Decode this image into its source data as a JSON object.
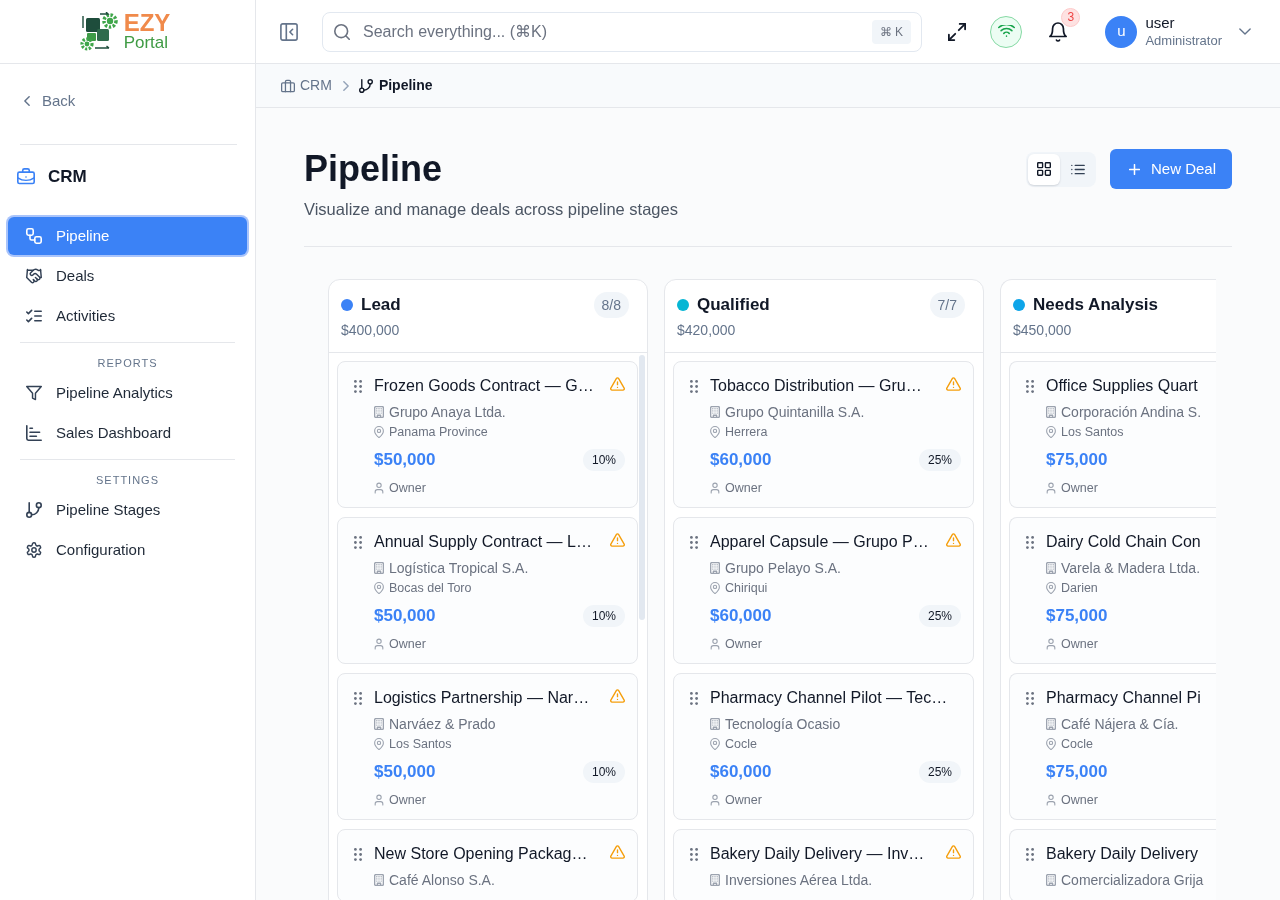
{
  "brand": {
    "name": "EZY",
    "tagline": "Portal"
  },
  "sidebar": {
    "back": "Back",
    "module": "CRM",
    "groups": [
      {
        "items": [
          {
            "kind": "pipeline",
            "label": "Pipeline",
            "selected": true
          },
          {
            "kind": "deals",
            "label": "Deals",
            "selected": false
          },
          {
            "kind": "activities",
            "label": "Activities",
            "selected": false
          }
        ]
      },
      {
        "heading": "REPORTS",
        "items": [
          {
            "kind": "analytics",
            "label": "Pipeline Analytics",
            "selected": false
          },
          {
            "kind": "dashboard",
            "label": "Sales Dashboard",
            "selected": false
          }
        ]
      },
      {
        "heading": "SETTINGS",
        "items": [
          {
            "kind": "stages",
            "label": "Pipeline Stages",
            "selected": false
          },
          {
            "kind": "configuration",
            "label": "Configuration",
            "selected": false
          }
        ]
      }
    ]
  },
  "topbar": {
    "search": {
      "placeholder": "Search everything... (⌘K)",
      "shortcut": "⌘ K"
    },
    "connected": true,
    "notifications": "3",
    "user": {
      "initial": "u",
      "name": "user",
      "role": "Administrator"
    }
  },
  "breadcrumb": [
    {
      "kind": "module",
      "label": "CRM",
      "current": false
    },
    {
      "kind": "pipeline",
      "label": "Pipeline",
      "current": true
    }
  ],
  "page": {
    "title": "Pipeline",
    "subtitle": "Visualize and manage deals across pipeline stages",
    "view_modes": [
      {
        "kind": "grid",
        "selected": true
      },
      {
        "kind": "list",
        "selected": false
      }
    ],
    "new_button": "New Deal"
  },
  "stages": [
    {
      "name": "Lead",
      "color": "#3b82f6",
      "count": "8/8",
      "total": "$400,000",
      "scrollbar": true,
      "deals": [
        {
          "title": "Frozen Goods Contract — G…",
          "company": "Grupo Anaya Ltda.",
          "location": "Panama Province",
          "amount": "$50,000",
          "probability": "10%",
          "owner": "Owner",
          "flagged": true
        },
        {
          "title": "Annual Supply Contract — L…",
          "company": "Logística Tropical S.A.",
          "location": "Bocas del Toro",
          "amount": "$50,000",
          "probability": "10%",
          "owner": "Owner",
          "flagged": true
        },
        {
          "title": "Logistics Partnership — Nar…",
          "company": "Narváez & Prado",
          "location": "Los Santos",
          "amount": "$50,000",
          "probability": "10%",
          "owner": "Owner",
          "flagged": true
        },
        {
          "title": "New Store Opening Packag…",
          "company": "Café Alonso S.A.",
          "flagged": true
        }
      ]
    },
    {
      "name": "Qualified",
      "color": "#06b6d4",
      "count": "7/7",
      "total": "$420,000",
      "scrollbar": false,
      "deals": [
        {
          "title": "Tobacco Distribution — Gru…",
          "company": "Grupo Quintanilla S.A.",
          "location": "Herrera",
          "amount": "$60,000",
          "probability": "25%",
          "owner": "Owner",
          "flagged": true
        },
        {
          "title": "Apparel Capsule — Grupo P…",
          "company": "Grupo Pelayo S.A.",
          "location": "Chiriqui",
          "amount": "$60,000",
          "probability": "25%",
          "owner": "Owner",
          "flagged": true
        },
        {
          "title": "Pharmacy Channel Pilot — Tec…",
          "company": "Tecnología Ocasio",
          "location": "Cocle",
          "amount": "$60,000",
          "probability": "25%",
          "owner": "Owner",
          "flagged": false
        },
        {
          "title": "Bakery Daily Delivery — Inv…",
          "company": "Inversiones Aérea Ltda.",
          "flagged": true
        }
      ]
    },
    {
      "name": "Needs Analysis",
      "color": "#0ea5e9",
      "total": "$450,000",
      "scrollbar": false,
      "deals": [
        {
          "title": "Office Supplies Quart",
          "company": "Corporación Andina S.",
          "location": "Los Santos",
          "amount": "$75,000",
          "owner": "Owner",
          "flagged": false
        },
        {
          "title": "Dairy Cold Chain Con",
          "company": "Varela & Madera Ltda.",
          "location": "Darien",
          "amount": "$75,000",
          "owner": "Owner",
          "flagged": false
        },
        {
          "title": "Pharmacy Channel Pi",
          "company": "Café Nájera & Cía.",
          "location": "Cocle",
          "amount": "$75,000",
          "owner": "Owner",
          "flagged": false
        },
        {
          "title": "Bakery Daily Delivery",
          "company": "Comercializadora Grija",
          "flagged": false
        }
      ]
    }
  ]
}
